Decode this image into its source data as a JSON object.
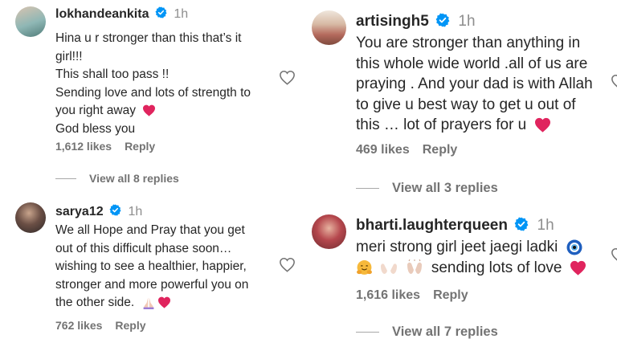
{
  "comments": [
    {
      "username": "lokhandeankita",
      "time": "1h",
      "lines": [
        "Hina u r stronger than this that’s it",
        "girl!!!",
        "This shall too pass !!",
        "Sending love and lots of strength to",
        "you right away",
        "God bless you"
      ],
      "likes": "1,612 likes",
      "reply": "Reply",
      "view_replies": "View all 8 replies"
    },
    {
      "username": "sarya12",
      "time": "1h",
      "lines": [
        "We all Hope and Pray that you get",
        "out of this difficult phase soon…",
        "wishing to see a healthier, happier,",
        "stronger and more powerful you on",
        "the other side."
      ],
      "likes": "762 likes",
      "reply": "Reply"
    },
    {
      "username": "artisingh5",
      "time": "1h",
      "lines": [
        "You are stronger than anything in",
        "this whole wide world .all of us are",
        "praying . And your dad is with Allah",
        "to give u best way to get u out of",
        "this … lot of prayers for u"
      ],
      "likes": "469 likes",
      "reply": "Reply",
      "view_replies": "View all 3 replies"
    },
    {
      "username": "bharti.laughterqueen",
      "time": "1h",
      "lines": [
        "meri strong girl jeet jaegi ladki",
        "sending lots of love"
      ],
      "likes": "1,616 likes",
      "reply": "Reply",
      "view_replies": "View all 7 replies"
    }
  ],
  "icons": {
    "verified": "verified-badge-icon",
    "like": "heart-outline-icon",
    "red_heart": "red-heart-emoji",
    "praying": "praying-hands-emoji",
    "evil_eye": "nazar-amulet-emoji",
    "hug": "hugging-face-emoji",
    "open_hands": "open-hands-emoji"
  },
  "colors": {
    "text": "#262626",
    "muted": "#737373",
    "verified": "#0095f6",
    "heart": "#e0245e"
  }
}
